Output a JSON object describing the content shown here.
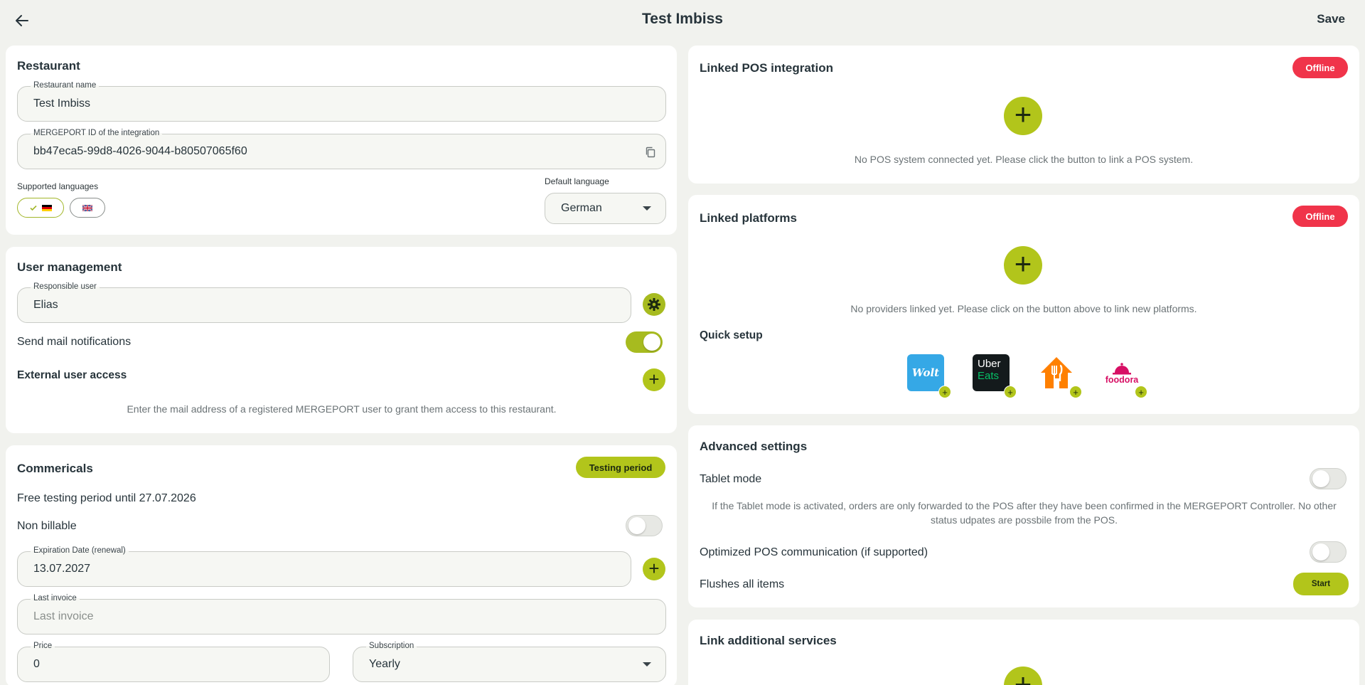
{
  "header": {
    "title": "Test Imbiss",
    "save_label": "Save",
    "back_icon": "arrow-left-icon"
  },
  "restaurant": {
    "title": "Restaurant",
    "name_label": "Restaurant name",
    "name_value": "Test Imbiss",
    "id_label": "MERGEPORT ID of the integration",
    "id_value": "bb47eca5-99d8-4026-9044-b80507065f60",
    "supported_languages_label": "Supported languages",
    "default_language_label": "Default language",
    "default_language_value": "German"
  },
  "user_management": {
    "title": "User management",
    "responsible_label": "Responsible user",
    "responsible_value": "Elias",
    "mail_notifications_label": "Send mail notifications",
    "mail_notifications_on": true,
    "external_access_label": "External user access",
    "external_access_help": "Enter the mail address of a registered MERGEPORT user to grant them access to this restaurant."
  },
  "commercials": {
    "title": "Commericals",
    "badge": "Testing period",
    "testing_text": "Free testing period until 27.07.2026",
    "non_billable_label": "Non billable",
    "expiration_label": "Expiration Date (renewal)",
    "expiration_value": "13.07.2027",
    "last_invoice_label": "Last invoice",
    "last_invoice_placeholder": "Last invoice",
    "price_label": "Price",
    "price_value": "0",
    "subscription_label": "Subscription",
    "subscription_value": "Yearly"
  },
  "pos": {
    "title": "Linked POS integration",
    "status": "Offline",
    "empty_text": "No POS system connected yet. Please click the button to link a POS system."
  },
  "platforms": {
    "title": "Linked platforms",
    "status": "Offline",
    "empty_text": "No providers linked yet. Please click on the button above to link new platforms.",
    "quick_setup_label": "Quick setup",
    "providers": [
      {
        "name": "Wolt",
        "logo_text": "Wolt"
      },
      {
        "name": "Uber Eats",
        "logo_text_1": "Uber",
        "logo_text_2": "Eats"
      },
      {
        "name": "Lieferando",
        "logo_text": ""
      },
      {
        "name": "foodora",
        "logo_text": "foodora"
      }
    ]
  },
  "advanced": {
    "title": "Advanced settings",
    "tablet_mode_label": "Tablet mode",
    "tablet_help": "If the Tablet mode is activated, orders are only forwarded to the POS after they have been confirmed in the MERGEPORT Controller. No other status udpates are possbile from the POS.",
    "optimized_label": "Optimized POS communication (if supported)",
    "flush_label": "Flushes all items",
    "start_label": "Start"
  },
  "additional": {
    "title": "Link additional services"
  },
  "colors": {
    "accent": "#b2c51b",
    "offline": "#f0344a",
    "background": "#f1f2ee"
  }
}
